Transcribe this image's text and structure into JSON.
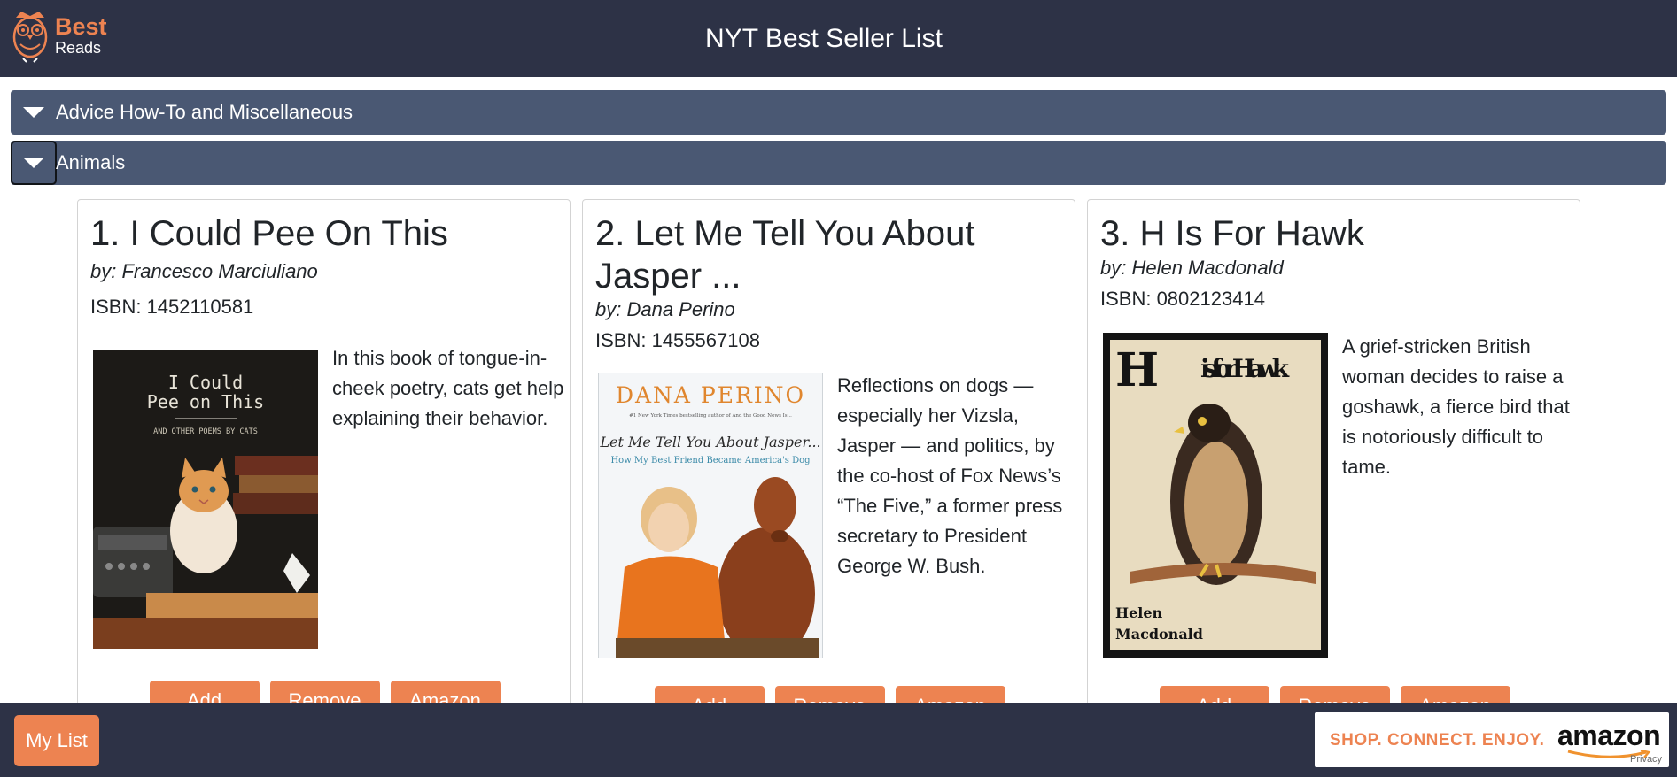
{
  "header": {
    "logo": {
      "best": "Best",
      "reads": "Reads"
    },
    "title": "NYT Best Seller List"
  },
  "categories": [
    {
      "label": "Advice How-To and Miscellaneous",
      "icon": "caret-down-icon"
    },
    {
      "label": "Animals",
      "icon": "caret-down-icon"
    }
  ],
  "books": [
    {
      "title": "1. I Could Pee On This",
      "author": "by: Francesco Marciuliano",
      "isbn": "ISBN: 1452110581",
      "description": "In this book of tongue-in-cheek poetry, cats get help explaining their behavior.",
      "cover_lines": [
        "I Could",
        "Pee on This"
      ],
      "cover_subtitle": "AND OTHER POEMS BY CATS",
      "buttons": [
        "Add",
        "Remove",
        "Amazon"
      ]
    },
    {
      "title": "2. Let Me Tell You About Jasper ...",
      "author": "by: Dana Perino",
      "isbn": "ISBN: 1455567108",
      "description": "Reflections on dogs — especially her Vizsla, Jasper — and politics, by the co-host of Fox News’s “The Five,” a former press secretary to President George W. Bush.",
      "cover_author": "DANA PERINO",
      "cover_tagline": "#1 New York Times bestselling author of And the Good News Is...",
      "cover_title": "Let Me Tell You About Jasper...",
      "cover_subtitle": "How My Best Friend Became America's Dog",
      "buttons": [
        "Add",
        "Remove",
        "Amazon"
      ]
    },
    {
      "title": "3. H Is For Hawk",
      "author": "by: Helen Macdonald",
      "isbn": "ISBN: 0802123414",
      "description": "A grief-stricken British woman decides to raise a goshawk, a fierce bird that is notoriously difficult to tame.",
      "cover_h": "H",
      "cover_title": "is for Hawk",
      "cover_author_1": "Helen",
      "cover_author_2": "Macdonald",
      "buttons": [
        "Add",
        "Remove",
        "Amazon"
      ]
    }
  ],
  "footer": {
    "my_list": "My List",
    "ad": {
      "slogan": "SHOP. CONNECT. ENJOY.",
      "brand": "amazon",
      "privacy": "Privacy"
    }
  },
  "colors": {
    "navy": "#2d3246",
    "slate": "#4a5873",
    "accent": "#ed8351"
  }
}
